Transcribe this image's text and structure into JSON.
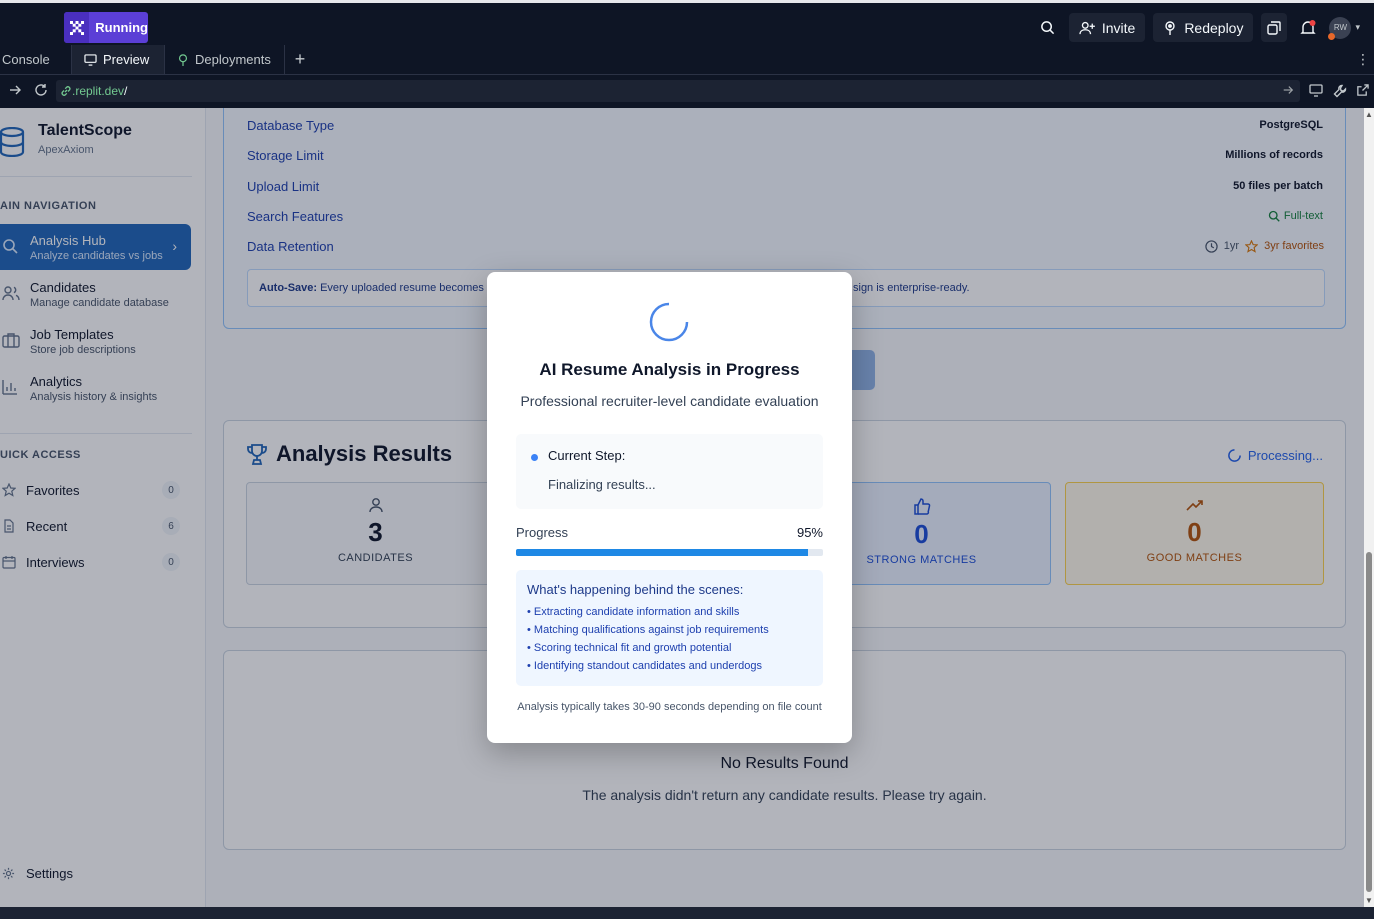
{
  "ide": {
    "run_status": "Running",
    "invite_label": "Invite",
    "redeploy_label": "Redeploy",
    "avatar_initials": "RW",
    "tabs": [
      {
        "label": "Console"
      },
      {
        "label": "Preview"
      },
      {
        "label": "Deployments"
      }
    ],
    "url": {
      "domain": ".replit.dev",
      "path": "/"
    }
  },
  "sidebar": {
    "app_name": "TalentScope",
    "org_name": "ApexAxiom",
    "main_nav_heading": "AIN NAVIGATION",
    "nav": [
      {
        "title": "Analysis Hub",
        "subtitle": "Analyze candidates vs jobs",
        "icon": "search-icon"
      },
      {
        "title": "Candidates",
        "subtitle": "Manage candidate database",
        "icon": "users-icon"
      },
      {
        "title": "Job Templates",
        "subtitle": "Store job descriptions",
        "icon": "briefcase-icon"
      },
      {
        "title": "Analytics",
        "subtitle": "Analysis history & insights",
        "icon": "bar-chart-icon"
      }
    ],
    "quick_access_heading": "UICK ACCESS",
    "quick_access": [
      {
        "label": "Favorites",
        "count": "0",
        "icon": "star-icon"
      },
      {
        "label": "Recent",
        "count": "6",
        "icon": "file-icon"
      },
      {
        "label": "Interviews",
        "count": "0",
        "icon": "calendar-icon"
      }
    ],
    "settings_label": "Settings"
  },
  "database": {
    "rows": [
      {
        "key": "Database Type",
        "value": "PostgreSQL"
      },
      {
        "key": "Storage Limit",
        "value": "Millions of records"
      },
      {
        "key": "Upload Limit",
        "value": "50 files per batch"
      },
      {
        "key": "Search Features",
        "value": "Full-text"
      },
      {
        "key": "Data Retention",
        "value_primary": "1yr",
        "value_secondary": "3yr favorites"
      }
    ],
    "autosave_label": "Auto-Save:",
    "autosave_text_start": "Every uploaded resume becomes a",
    "autosave_text_end": "sign is enterprise-ready."
  },
  "results": {
    "title": "Analysis Results",
    "status": "Processing...",
    "stats": [
      {
        "value": "3",
        "label": "CANDIDATES"
      },
      {
        "value": "0",
        "label": "STRONG MATCHES"
      },
      {
        "value": "0",
        "label": "GOOD MATCHES"
      }
    ],
    "empty_title": "No Results Found",
    "empty_text": "The analysis didn't return any candidate results. Please try again."
  },
  "modal": {
    "title": "AI Resume Analysis in Progress",
    "subtitle": "Professional recruiter-level candidate evaluation",
    "step_label": "Current Step:",
    "step_value": "Finalizing results...",
    "progress_label": "Progress",
    "progress_text": "95%",
    "progress_value": 0.95,
    "scenes_title": "What's happening behind the scenes:",
    "scenes": [
      "• Extracting candidate information and skills",
      "• Matching qualifications against job requirements",
      "• Scoring technical fit and growth potential",
      "• Identifying standout candidates and underdogs"
    ],
    "footer": "Analysis typically takes 30-90 seconds depending on file count"
  },
  "colors": {
    "accent": "#2166b8",
    "progress": "#1e88e5",
    "run_button": "#5b3fd6",
    "strong_match": "#1d4ed8",
    "good_match": "#b45309"
  }
}
